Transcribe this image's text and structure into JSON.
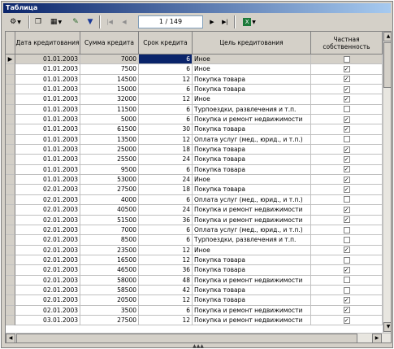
{
  "window": {
    "title": "Таблица"
  },
  "toolbar": {
    "pager_value": "1 / 149",
    "icons": [
      "gear-icon",
      "copy-icon",
      "grid-options-icon",
      "clear-filter-icon",
      "filter-icon",
      "first-record-icon",
      "prev-record-icon",
      "next-record-icon",
      "last-record-icon",
      "excel-export-icon"
    ]
  },
  "grid": {
    "columns": [
      "Дата кредитования",
      "Сумма кредита",
      "Срок кредита",
      "Цель кредитования",
      "Частная собственность"
    ],
    "rows": [
      [
        "01.01.2003",
        "7000",
        "6",
        "Иное",
        false
      ],
      [
        "01.01.2003",
        "7500",
        "6",
        "Иное",
        true
      ],
      [
        "01.01.2003",
        "14500",
        "12",
        "Покупка товара",
        true
      ],
      [
        "01.01.2003",
        "15000",
        "6",
        "Покупка товара",
        true
      ],
      [
        "01.01.2003",
        "32000",
        "12",
        "Иное",
        true
      ],
      [
        "01.01.2003",
        "11500",
        "6",
        "Турпоездки, развлечения и т.п.",
        false
      ],
      [
        "01.01.2003",
        "5000",
        "6",
        "Покупка и ремонт недвижимости",
        true
      ],
      [
        "01.01.2003",
        "61500",
        "30",
        "Покупка товара",
        true
      ],
      [
        "01.01.2003",
        "13500",
        "12",
        "Оплата услуг (мед., юрид., и т.п.)",
        false
      ],
      [
        "01.01.2003",
        "25000",
        "18",
        "Покупка товара",
        true
      ],
      [
        "01.01.2003",
        "25500",
        "24",
        "Покупка товара",
        true
      ],
      [
        "01.01.2003",
        "9500",
        "6",
        "Покупка товара",
        true
      ],
      [
        "01.01.2003",
        "53000",
        "24",
        "Иное",
        true
      ],
      [
        "02.01.2003",
        "27500",
        "18",
        "Покупка товара",
        true
      ],
      [
        "02.01.2003",
        "4000",
        "6",
        "Оплата услуг (мед., юрид., и т.п.)",
        false
      ],
      [
        "02.01.2003",
        "40500",
        "24",
        "Покупка и ремонт недвижимости",
        true
      ],
      [
        "02.01.2003",
        "51500",
        "36",
        "Покупка и ремонт недвижимости",
        true
      ],
      [
        "02.01.2003",
        "7000",
        "6",
        "Оплата услуг (мед., юрид., и т.п.)",
        false
      ],
      [
        "02.01.2003",
        "8500",
        "6",
        "Турпоездки, развлечения и т.п.",
        false
      ],
      [
        "02.01.2003",
        "23500",
        "12",
        "Иное",
        true
      ],
      [
        "02.01.2003",
        "16500",
        "12",
        "Покупка товара",
        false
      ],
      [
        "02.01.2003",
        "46500",
        "36",
        "Покупка товара",
        true
      ],
      [
        "02.01.2003",
        "58000",
        "48",
        "Покупка и ремонт недвижимости",
        false
      ],
      [
        "02.01.2003",
        "58500",
        "42",
        "Покупка товара",
        false
      ],
      [
        "02.01.2003",
        "20500",
        "12",
        "Покупка товара",
        true
      ],
      [
        "02.01.2003",
        "3500",
        "6",
        "Покупка и ремонт недвижимости",
        true
      ],
      [
        "03.01.2003",
        "27500",
        "12",
        "Покупка и ремонт недвижимости",
        true
      ]
    ]
  }
}
